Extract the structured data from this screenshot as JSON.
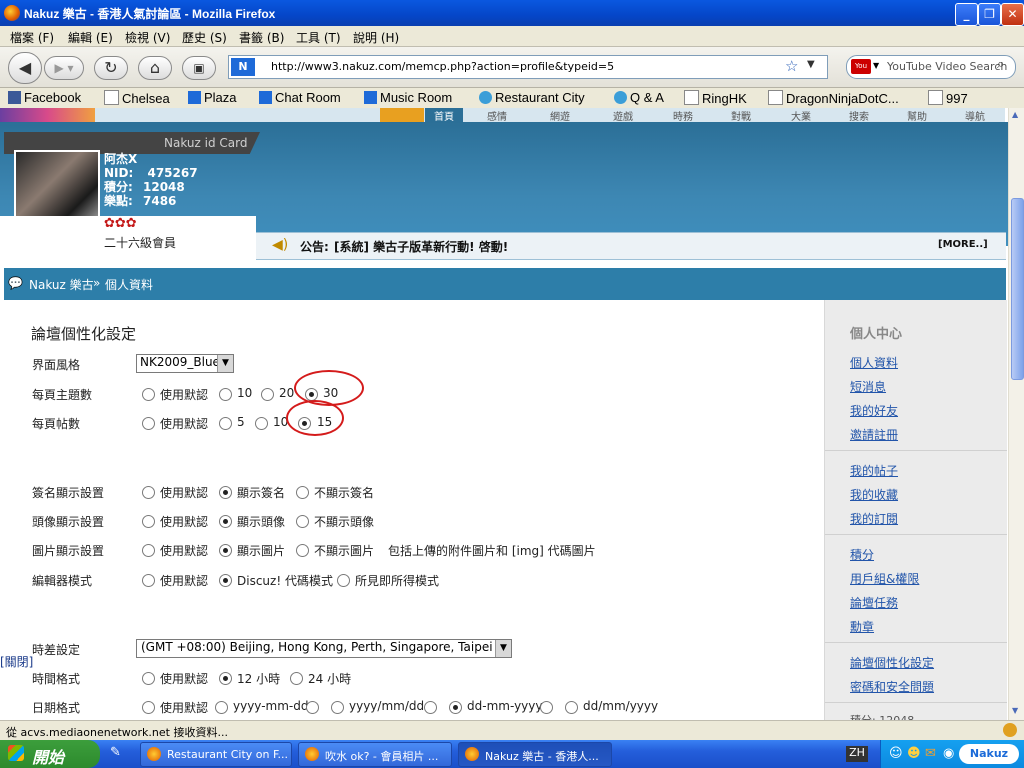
{
  "window": {
    "title": "Nakuz 樂古 - 香港人氣討論區 - Mozilla Firefox",
    "min": "_",
    "max": "❐",
    "close": "✕"
  },
  "menu": [
    "檔案 (F)",
    "編輯 (E)",
    "檢視 (V)",
    "歷史 (S)",
    "書籤 (B)",
    "工具 (T)",
    "說明 (H)"
  ],
  "nav": {
    "url": "http://www3.nakuz.com/memcp.php?action=profile&typeid=5",
    "search_placeholder": "YouTube Video Search"
  },
  "bookmarks": [
    "Facebook",
    "Chelsea",
    "Plaza",
    "Chat Room",
    "Music Room",
    "Restaurant City",
    "Q & A",
    "RingHK",
    "DragonNinjaDotC...",
    "997"
  ],
  "header": {
    "tabs": [
      "首頁",
      "感情",
      "網遊",
      "遊戲",
      "時務",
      "對戰",
      "大業",
      "搜索",
      "幫助",
      "導航"
    ],
    "idcard_label": "Nakuz id Card",
    "user": {
      "name": "阿杰X",
      "nid_label": "NID:",
      "nid": "475267",
      "points_label": "積分:",
      "points": "12048",
      "coins_label": "樂點:",
      "coins": "7486",
      "level": "二十六級會員"
    },
    "notice_label": "公告:",
    "notice_text": "[系統] 樂古子版革新行動! 啓動!",
    "more": "[MORE..]"
  },
  "breadcrumb": {
    "site": "Nakuz 樂古",
    "sep": "»",
    "page": "個人資料"
  },
  "form": {
    "title": "論壇個性化設定",
    "rows": [
      {
        "label": "界面風格",
        "select": "NK2009_Blue"
      },
      {
        "label": "每頁主題數",
        "options": [
          "使用默認",
          "10",
          "20",
          "30"
        ],
        "selected": 3
      },
      {
        "label": "每頁帖數",
        "options": [
          "使用默認",
          "5",
          "10",
          "15"
        ],
        "selected": 3
      },
      {
        "label": "簽名顯示設置",
        "options": [
          "使用默認",
          "顯示簽名",
          "不顯示簽名"
        ],
        "selected": 1
      },
      {
        "label": "頭像顯示設置",
        "options": [
          "使用默認",
          "顯示頭像",
          "不顯示頭像"
        ],
        "selected": 1
      },
      {
        "label": "圖片顯示設置",
        "options": [
          "使用默認",
          "顯示圖片",
          "不顯示圖片"
        ],
        "selected": 1,
        "note": "包括上傳的附件圖片和 [img] 代碼圖片"
      },
      {
        "label": "編輯器模式",
        "options": [
          "使用默認",
          "Discuz! 代碼模式",
          "所見即所得模式"
        ],
        "selected": 1
      },
      {
        "label": "時差設定",
        "select": "(GMT +08:00) Beijing, Hong Kong, Perth, Singapore, Taipei"
      },
      {
        "label": "時間格式",
        "options": [
          "使用默認",
          "12 小時",
          "24 小時"
        ],
        "selected": 1
      },
      {
        "label": "日期格式",
        "options": [
          "使用默認",
          "yyyy-mm-dd",
          "",
          "yyyy/mm/dd",
          "dd-mm-yyyy",
          "dd/mm/yyyy"
        ],
        "selected": 4
      }
    ],
    "close_label": "[關閉]"
  },
  "sidebar": {
    "title": "個人中心",
    "groups": [
      [
        "個人資料",
        "短消息",
        "我的好友",
        "邀請註冊"
      ],
      [
        "我的帖子",
        "我的收藏",
        "我的訂閱"
      ],
      [
        "積分",
        "用戶組&權限",
        "論壇任務",
        "勳章"
      ],
      [
        "論壇個性化設定",
        "密碼和安全問題"
      ]
    ],
    "footer": "積分: 12048"
  },
  "status": "從 acvs.mediaonenetwork.net 接收資料...",
  "taskbar": {
    "start": "開始",
    "tasks": [
      "Restaurant City on F...",
      "吹水 ok? - 會員相片 ...",
      "Nakuz 樂古 - 香港人..."
    ],
    "lang": "ZH"
  }
}
